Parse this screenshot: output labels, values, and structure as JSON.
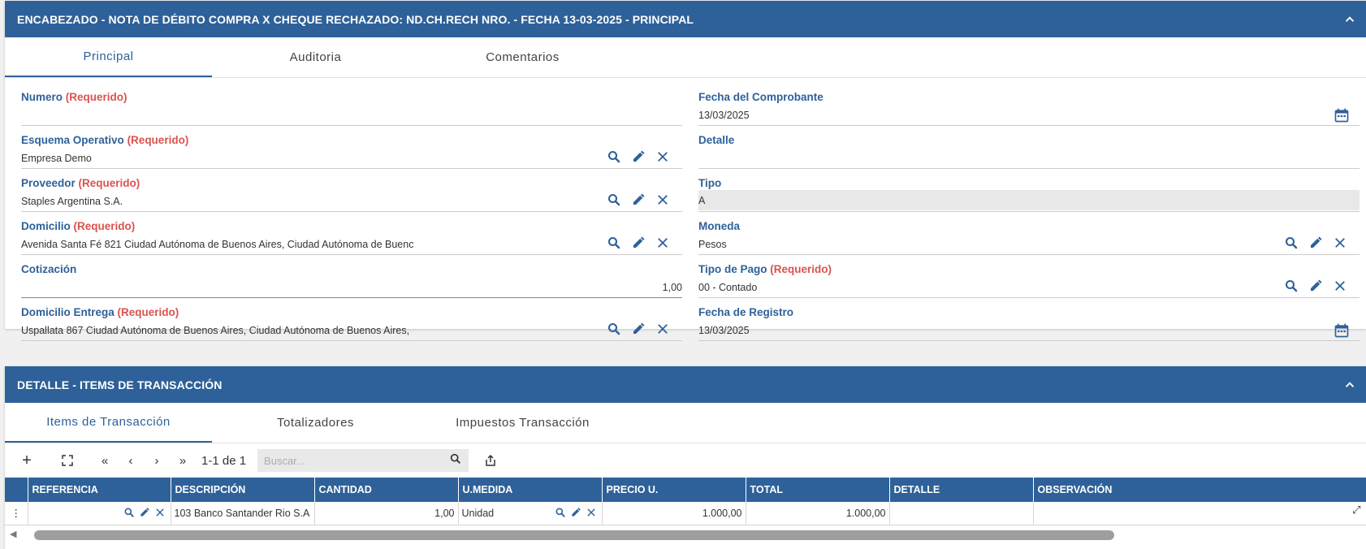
{
  "header_panel": {
    "title": "ENCABEZADO - NOTA DE DÉBITO COMPRA X CHEQUE RECHAZADO: ND.CH.RECH NRO. - FECHA 13-03-2025 - PRINCIPAL",
    "tabs": [
      {
        "label": "Principal"
      },
      {
        "label": "Auditoria"
      },
      {
        "label": "Comentarios"
      }
    ]
  },
  "required_text": "(Requerido)",
  "fields": {
    "numero": {
      "label": "Numero",
      "value": ""
    },
    "fecha_comprobante": {
      "label": "Fecha del Comprobante",
      "value": "13/03/2025"
    },
    "esquema": {
      "label": "Esquema Operativo",
      "value": "Empresa Demo"
    },
    "detalle": {
      "label": "Detalle",
      "value": ""
    },
    "proveedor": {
      "label": "Proveedor",
      "value": "Staples Argentina S.A."
    },
    "tipo": {
      "label": "Tipo",
      "value": "A"
    },
    "domicilio": {
      "label": "Domicilio",
      "value": "Avenida Santa Fé 821  Ciudad Autónoma de Buenos Aires, Ciudad Autónoma de Buenc"
    },
    "moneda": {
      "label": "Moneda",
      "value": "Pesos"
    },
    "cotizacion": {
      "label": "Cotización",
      "value": "1,00"
    },
    "tipo_pago": {
      "label": "Tipo de Pago",
      "value": "00 - Contado"
    },
    "domicilio_entrega": {
      "label": "Domicilio Entrega",
      "value": "Uspallata 867  Ciudad Autónoma de Buenos Aires, Ciudad Autónoma de Buenos Aires,"
    },
    "fecha_registro": {
      "label": "Fecha de Registro",
      "value": "13/03/2025"
    }
  },
  "detail_panel": {
    "title": "DETALLE - ITEMS DE TRANSACCIÓN",
    "tabs": [
      {
        "label": "Items de Transacción"
      },
      {
        "label": "Totalizadores"
      },
      {
        "label": "Impuestos Transacción"
      }
    ],
    "pager": "1-1 de 1",
    "search_placeholder": "Buscar...",
    "columns": [
      "REFERENCIA",
      "DESCRIPCIÓN",
      "CANTIDAD",
      "U.MEDIDA",
      "PRECIO U.",
      "TOTAL",
      "DETALLE",
      "OBSERVACIÓN"
    ],
    "rows": [
      {
        "referencia": "",
        "descripcion": "103 Banco Santander Rio S.A",
        "cantidad": "1,00",
        "umedida": "Unidad",
        "precio": "1.000,00",
        "total": "1.000,00",
        "detalle": "",
        "observacion": ""
      }
    ]
  },
  "colors": {
    "primary": "#2e6199",
    "required": "#d9534f"
  },
  "icons": [
    "chevron-up-icon",
    "search-icon",
    "pencil-icon",
    "close-icon",
    "calendar-icon",
    "plus-icon",
    "expand-icon",
    "first-page-icon",
    "prev-page-icon",
    "next-page-icon",
    "last-page-icon",
    "export-icon",
    "more-vert-icon"
  ]
}
